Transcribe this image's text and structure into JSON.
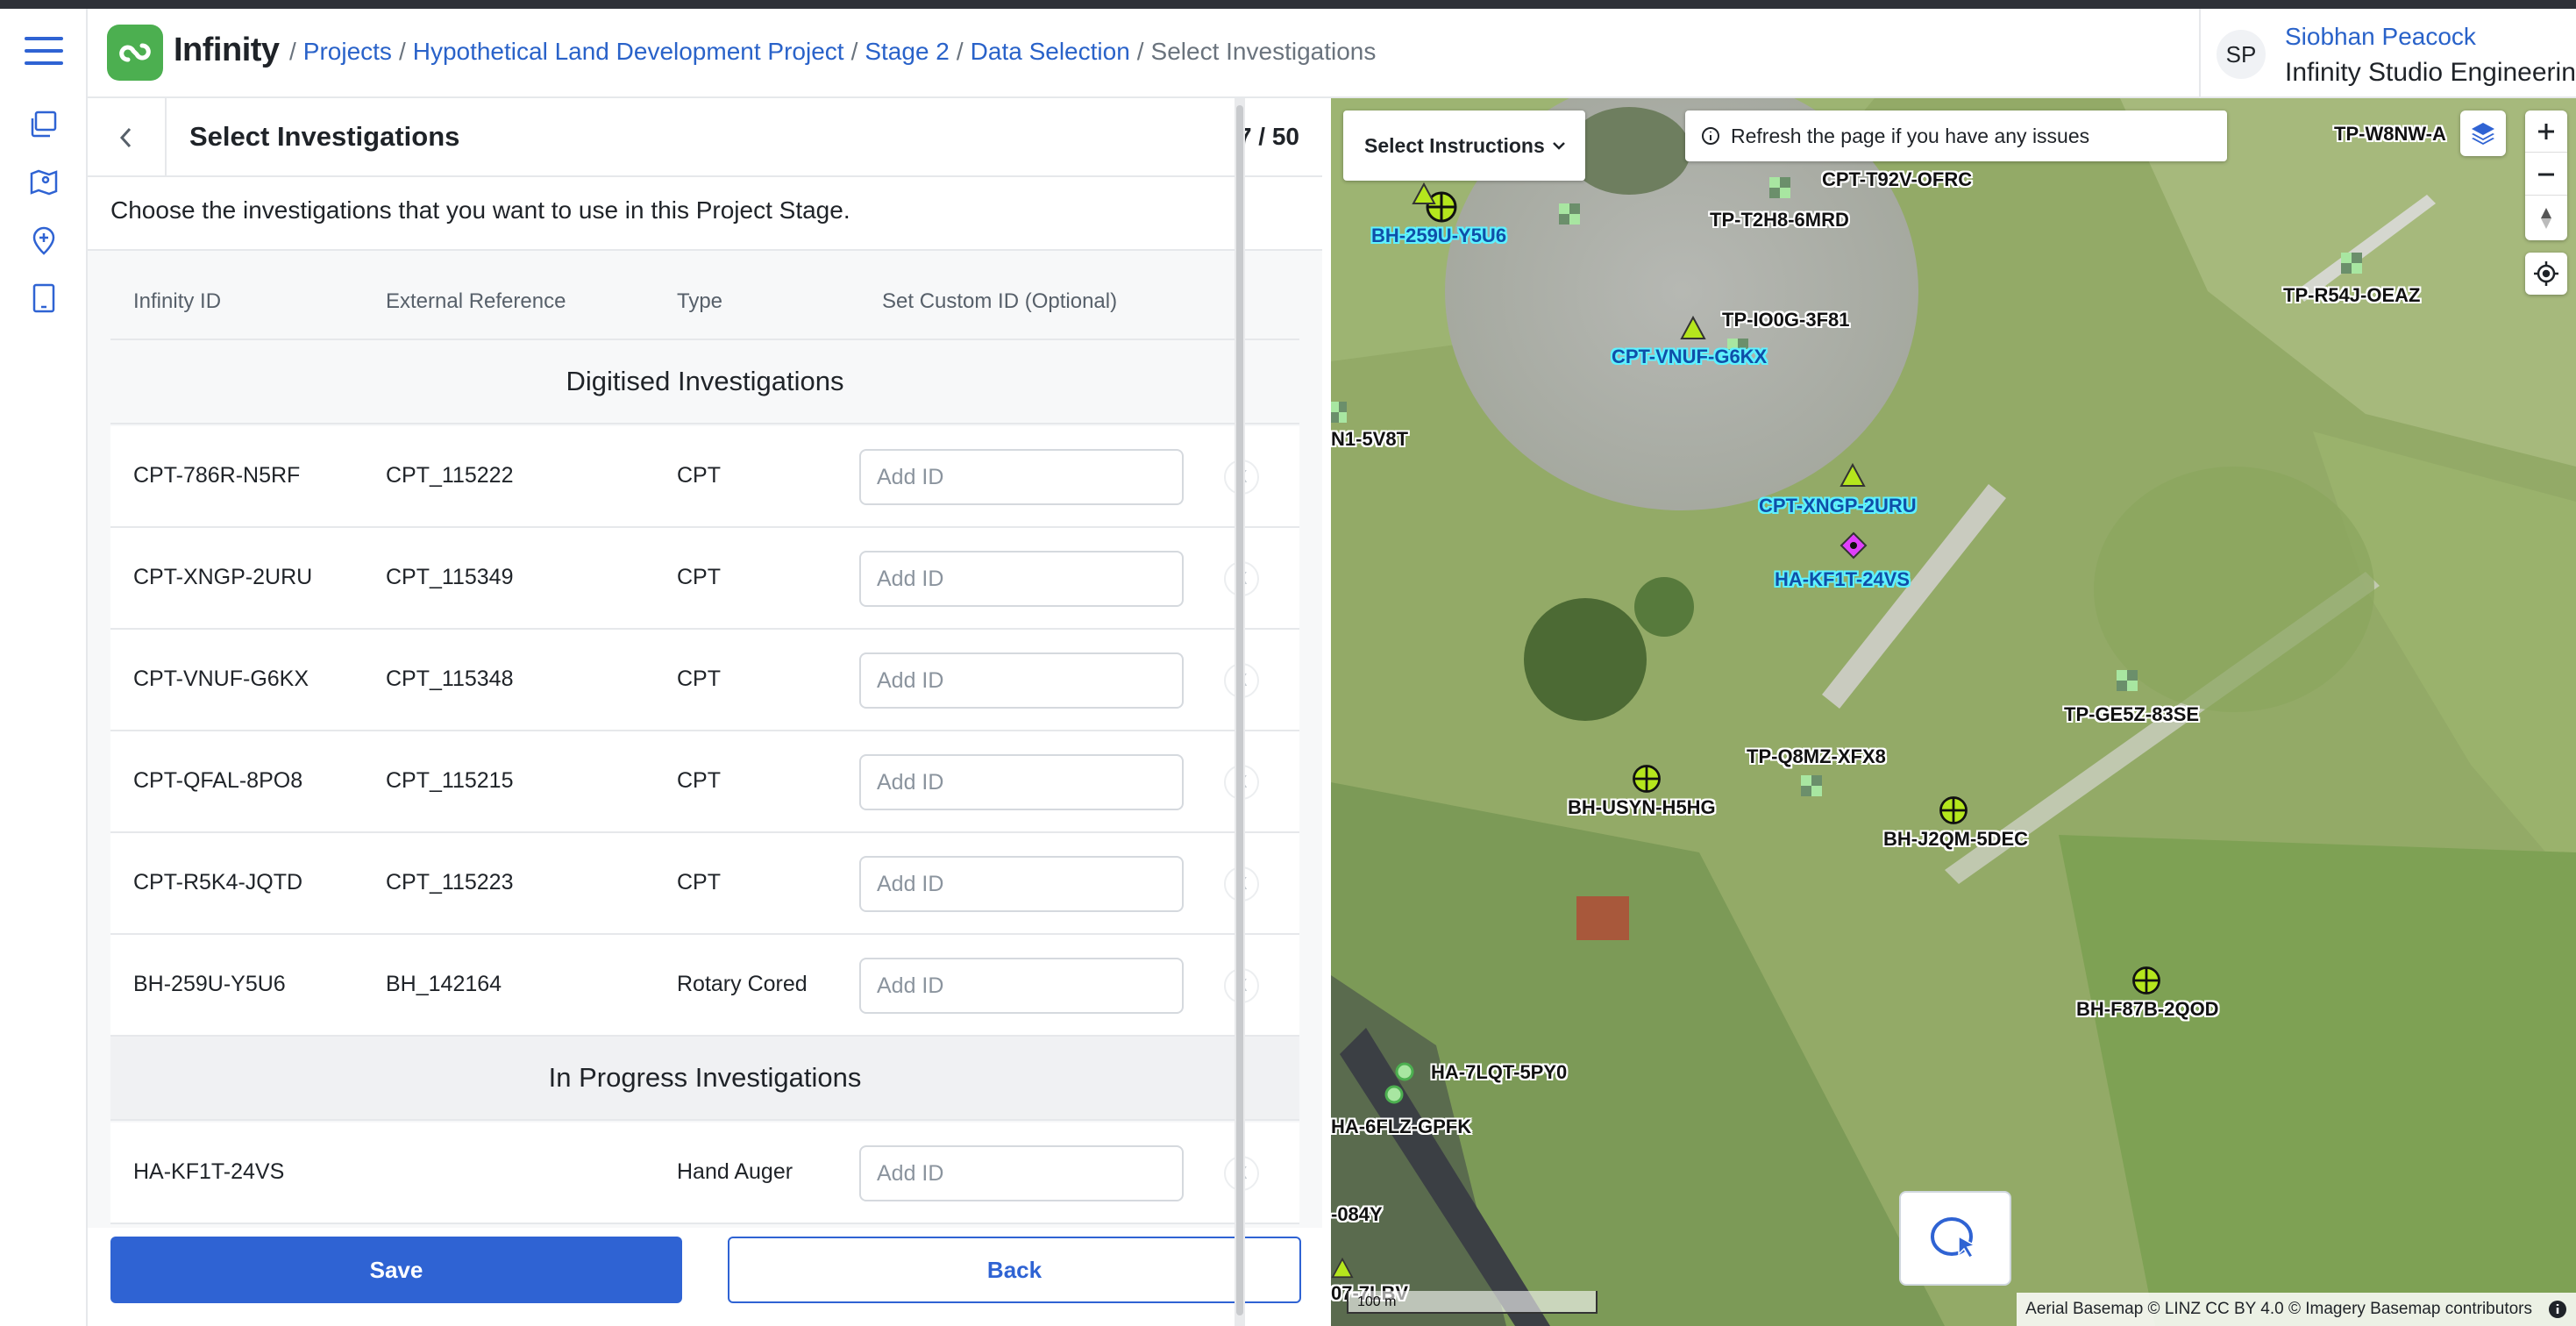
{
  "app": {
    "name": "Infinity"
  },
  "breadcrumbs": [
    {
      "label": "Projects"
    },
    {
      "label": "Hypothetical Land Development Project"
    },
    {
      "label": "Stage 2"
    },
    {
      "label": "Data Selection"
    },
    {
      "label": "Select Investigations"
    }
  ],
  "user": {
    "initials": "SP",
    "name": "Siobhan Peacock",
    "org": "Infinity Studio Engineering"
  },
  "sidebar": {
    "icons": [
      "menu-icon",
      "projects-icon",
      "map-icon",
      "location-pin-icon",
      "tablet-icon"
    ]
  },
  "panel": {
    "title": "Select Investigations",
    "counter": "7 / 50",
    "instruction": "Choose the investigations that you want to use in this Project Stage.",
    "columns": [
      "Infinity ID",
      "External Reference",
      "Type",
      "Set Custom ID (Optional)"
    ],
    "input_placeholder": "Add ID",
    "clear_symbol": "X",
    "sections": [
      {
        "title": "Digitised Investigations",
        "rows": [
          {
            "id": "CPT-786R-N5RF",
            "ref": "CPT_115222",
            "type": "CPT"
          },
          {
            "id": "CPT-XNGP-2URU",
            "ref": "CPT_115349",
            "type": "CPT"
          },
          {
            "id": "CPT-VNUF-G6KX",
            "ref": "CPT_115348",
            "type": "CPT"
          },
          {
            "id": "CPT-QFAL-8PO8",
            "ref": "CPT_115215",
            "type": "CPT"
          },
          {
            "id": "CPT-R5K4-JQTD",
            "ref": "CPT_115223",
            "type": "CPT"
          },
          {
            "id": "BH-259U-Y5U6",
            "ref": "BH_142164",
            "type": "Rotary Cored"
          }
        ]
      },
      {
        "title": "In Progress Investigations",
        "rows": [
          {
            "id": "HA-KF1T-24VS",
            "ref": "",
            "type": "Hand Auger"
          }
        ]
      }
    ],
    "save_label": "Save",
    "back_label": "Back"
  },
  "map": {
    "select_instructions": "Select Instructions",
    "notice": "Refresh the page if you have any issues",
    "attribution": "Aerial Basemap © LINZ CC BY 4.0 © Imagery Basemap contributors",
    "scale": "100 m",
    "labels": {
      "bh259": "BH-259U-Y5U6",
      "cptT92": "CPT-T92V-OFRC",
      "tpT2H8": "TP-T2H8-6MRD",
      "tpW8": "TP-W8NW-A",
      "tpR54": "TP-R54J-OEAZ",
      "tpIO0G": "TP-IO0G-3F81",
      "cptVNUF": "CPT-VNUF-G6KX",
      "n15v8t": "N1-5V8T",
      "cptXNGP": "CPT-XNGP-2URU",
      "haKF1T": "HA-KF1T-24VS",
      "tpGE5Z": "TP-GE5Z-83SE",
      "tpQ8MZ": "TP-Q8MZ-XFX8",
      "bhUSYN": "BH-USYN-H5HG",
      "bhJ2QM": "BH-J2QM-5DEC",
      "bhF87B": "BH-F87B-2QOD",
      "ha7LQT": "HA-7LQT-5PY0",
      "ha6FLZ": "HA-6FLZ-GPFK",
      "t084y": "-084Y",
      "t7lbv": "07-7LBV"
    },
    "colors": {
      "selected_label": "#5ff2ff",
      "cpt_marker": "#b5e61d",
      "bh_marker": "#b5e61d",
      "ha_selected": "#e040fb",
      "tp_marker": "#a8e6a1"
    }
  }
}
